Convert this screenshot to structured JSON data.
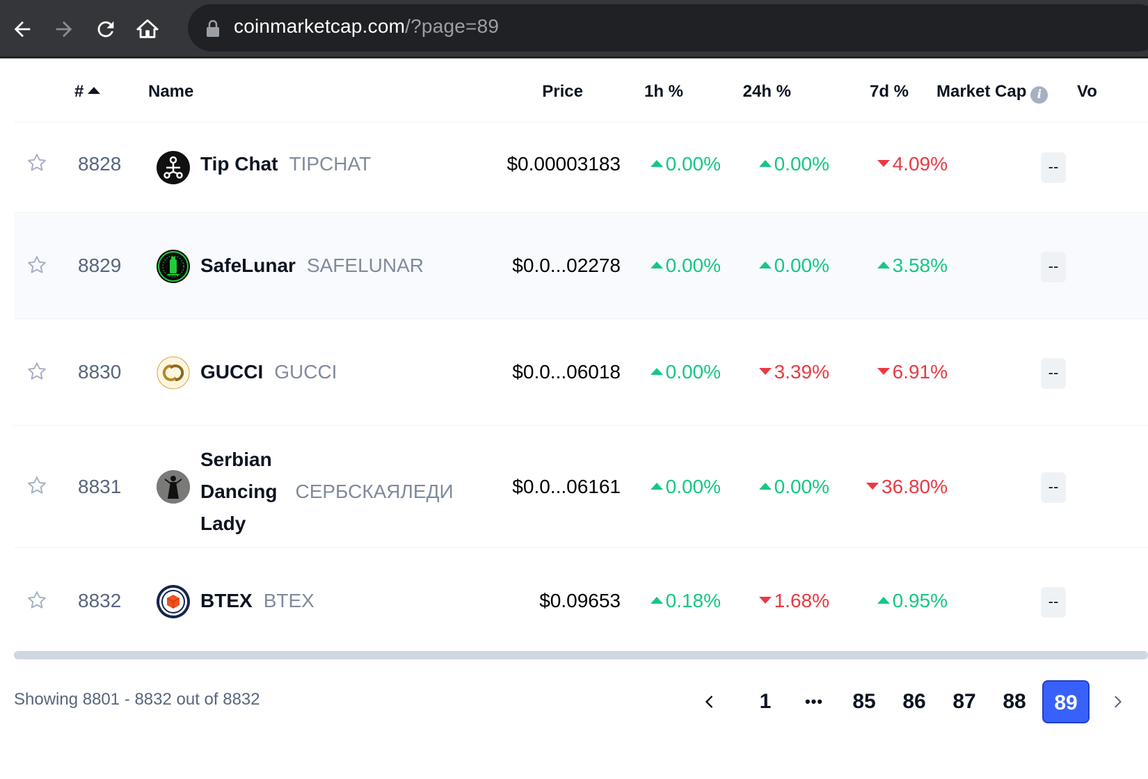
{
  "browser": {
    "url_main": "coinmarketcap.com",
    "url_query": "/?page=89"
  },
  "table": {
    "headers": {
      "rank": "#",
      "name": "Name",
      "price": "Price",
      "h1": "1h %",
      "h24": "24h %",
      "d7": "7d %",
      "market_cap": "Market Cap",
      "volume_partial": "Vo"
    },
    "rows": [
      {
        "rank": "8828",
        "name": "Tip Chat",
        "symbol": "TIPCHAT",
        "price": "$0.00003183",
        "h1": "0.00%",
        "h1_dir": "up",
        "h24": "0.00%",
        "h24_dir": "up",
        "d7": "4.09%",
        "d7_dir": "down",
        "market_cap": "--"
      },
      {
        "rank": "8829",
        "name": "SafeLunar",
        "symbol": "SAFELUNAR",
        "price": "$0.0...02278",
        "h1": "0.00%",
        "h1_dir": "up",
        "h24": "0.00%",
        "h24_dir": "up",
        "d7": "3.58%",
        "d7_dir": "up",
        "market_cap": "--"
      },
      {
        "rank": "8830",
        "name": "GUCCI",
        "symbol": "GUCCI",
        "price": "$0.0...06018",
        "h1": "0.00%",
        "h1_dir": "up",
        "h24": "3.39%",
        "h24_dir": "down",
        "d7": "6.91%",
        "d7_dir": "down",
        "market_cap": "--"
      },
      {
        "rank": "8831",
        "name_line1": "Serbian",
        "name_line2": "Dancing",
        "name_line3": "Lady",
        "symbol": "СЕРБСКАЯЛЕДИ",
        "price": "$0.0...06161",
        "h1": "0.00%",
        "h1_dir": "up",
        "h24": "0.00%",
        "h24_dir": "up",
        "d7": "36.80%",
        "d7_dir": "down",
        "market_cap": "--"
      },
      {
        "rank": "8832",
        "name": "BTEX",
        "symbol": "BTEX",
        "price": "$0.09653",
        "h1": "0.18%",
        "h1_dir": "up",
        "h24": "1.68%",
        "h24_dir": "down",
        "d7": "0.95%",
        "d7_dir": "up",
        "market_cap": "--"
      }
    ]
  },
  "footer": {
    "showing": "Showing 8801 - 8832 out of 8832",
    "pages": [
      "1",
      "•••",
      "85",
      "86",
      "87",
      "88",
      "89"
    ],
    "current_page": "89"
  },
  "colors": {
    "up": "#16c784",
    "down": "#ea3943",
    "accent": "#3861fb"
  }
}
